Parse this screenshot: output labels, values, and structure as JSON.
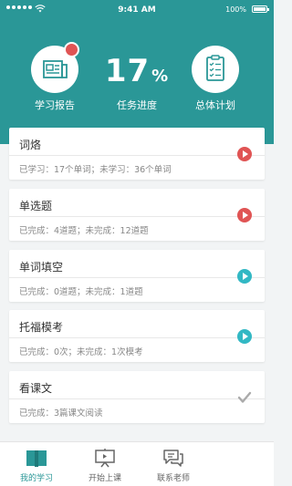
{
  "status_bar": {
    "time": "9:41 AM",
    "battery": "100%"
  },
  "header": {
    "report_label": "学习报告",
    "progress_number": "17",
    "progress_unit": "%",
    "progress_label": "任务进度",
    "plan_label": "总体计划",
    "progress_fraction": 0.17
  },
  "cards": [
    {
      "title": "词烙",
      "subtitle": "已学习：17个单词；未学习：36个单词",
      "status": "play-red"
    },
    {
      "title": "单选题",
      "subtitle": "已完成：4道题；未完成：12道题",
      "status": "play-red"
    },
    {
      "title": "单词填空",
      "subtitle": "已完成：0道题；未完成：1道题",
      "status": "play-teal"
    },
    {
      "title": "托福模考",
      "subtitle": "已完成：0次；未完成：1次模考",
      "status": "play-teal"
    },
    {
      "title": "看课文",
      "subtitle": "已完成：3篇课文阅读",
      "status": "done-check"
    }
  ],
  "tabbar": {
    "items": [
      {
        "label": "我的学习",
        "icon": "book-icon",
        "active": true
      },
      {
        "label": "开始上课",
        "icon": "presentation-icon",
        "active": false
      },
      {
        "label": "联系老师",
        "icon": "chat-icon",
        "active": false
      }
    ]
  },
  "colors": {
    "brand_teal": "#2a9797",
    "play_red": "#e05454",
    "play_teal": "#32b8c4",
    "check_gray": "#aaaaaa"
  }
}
